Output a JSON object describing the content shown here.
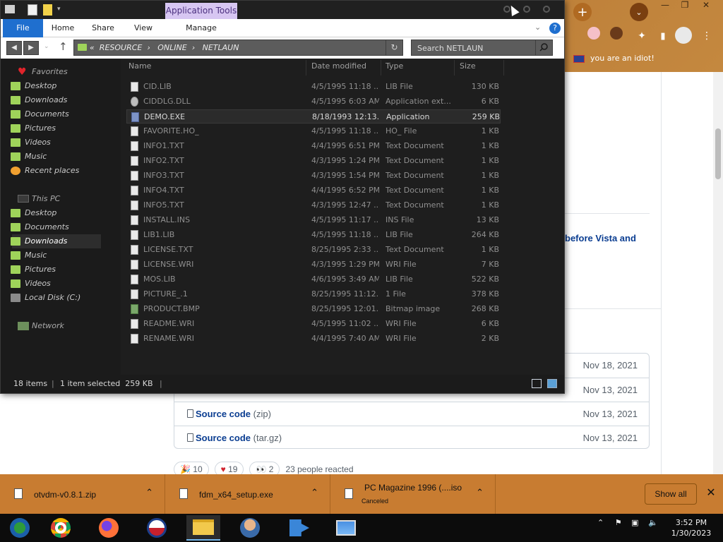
{
  "browser": {
    "bookmark_text": "you are an idiot!",
    "heading_fragment": "before Vista and",
    "assets": [
      {
        "name": "",
        "ext": "",
        "date": "Nov 18, 2021"
      },
      {
        "name": "",
        "ext": "",
        "date": "Nov 13, 2021"
      },
      {
        "name": "Source code",
        "ext": "(zip)",
        "date": "Nov 13, 2021"
      },
      {
        "name": "Source code",
        "ext": "(tar.gz)",
        "date": "Nov 13, 2021"
      }
    ],
    "reactions": {
      "tada": "10",
      "heart": "19",
      "eyes": "2",
      "summary": "23 people reacted"
    }
  },
  "explorer": {
    "contextual_tab": "Application Tools",
    "ribbon_tabs": [
      "File",
      "Home",
      "Share",
      "View",
      "Manage"
    ],
    "address_prefix": "«",
    "address_crumbs": [
      "RESOURCE",
      "ONLINE",
      "NETLAUN"
    ],
    "search_placeholder": "Search NETLAUN",
    "columns": {
      "name": "Name",
      "date": "Date modified",
      "type": "Type",
      "size": "Size"
    },
    "nav": {
      "favorites": "Favorites",
      "fav_items": [
        "Desktop",
        "Downloads",
        "Documents",
        "Pictures",
        "Videos",
        "Music",
        "Recent places"
      ],
      "this_pc": "This PC",
      "pc_items": [
        "Desktop",
        "Documents",
        "Downloads",
        "Music",
        "Pictures",
        "Videos",
        "Local Disk (C:)"
      ],
      "network": "Network"
    },
    "files": [
      {
        "name": "CID.LIB",
        "date": "4/5/1995 11:18 ...",
        "type": "LIB File",
        "size": "130 KB",
        "icon": "file"
      },
      {
        "name": "CIDDLG.DLL",
        "date": "4/5/1995 6:03 AM",
        "type": "Application ext...",
        "size": "6 KB",
        "icon": "gear"
      },
      {
        "name": "DEMO.EXE",
        "date": "8/18/1993 12:13...",
        "type": "Application",
        "size": "259 KB",
        "icon": "app"
      },
      {
        "name": "FAVORITE.HO_",
        "date": "4/5/1995 11:18 ...",
        "type": "HO_ File",
        "size": "1 KB",
        "icon": "file"
      },
      {
        "name": "INFO1.TXT",
        "date": "4/4/1995 6:51 PM",
        "type": "Text Document",
        "size": "1 KB",
        "icon": "file"
      },
      {
        "name": "INFO2.TXT",
        "date": "4/3/1995 1:24 PM",
        "type": "Text Document",
        "size": "1 KB",
        "icon": "file"
      },
      {
        "name": "INFO3.TXT",
        "date": "4/3/1995 1:54 PM",
        "type": "Text Document",
        "size": "1 KB",
        "icon": "file"
      },
      {
        "name": "INFO4.TXT",
        "date": "4/4/1995 6:52 PM",
        "type": "Text Document",
        "size": "1 KB",
        "icon": "file"
      },
      {
        "name": "INFO5.TXT",
        "date": "4/3/1995 12:47 ...",
        "type": "Text Document",
        "size": "1 KB",
        "icon": "file"
      },
      {
        "name": "INSTALL.INS",
        "date": "4/5/1995 11:17 ...",
        "type": "INS File",
        "size": "13 KB",
        "icon": "file"
      },
      {
        "name": "LIB1.LIB",
        "date": "4/5/1995 11:18 ...",
        "type": "LIB File",
        "size": "264 KB",
        "icon": "file"
      },
      {
        "name": "LICENSE.TXT",
        "date": "8/25/1995 2:33 ...",
        "type": "Text Document",
        "size": "1 KB",
        "icon": "file"
      },
      {
        "name": "LICENSE.WRI",
        "date": "4/3/1995 1:29 PM",
        "type": "WRI File",
        "size": "7 KB",
        "icon": "file"
      },
      {
        "name": "MOS.LIB",
        "date": "4/6/1995 3:49 AM",
        "type": "LIB File",
        "size": "522 KB",
        "icon": "file"
      },
      {
        "name": "PICTURE_.1",
        "date": "8/25/1995 11:12...",
        "type": "1 File",
        "size": "378 KB",
        "icon": "file"
      },
      {
        "name": "PRODUCT.BMP",
        "date": "8/25/1995 12:01...",
        "type": "Bitmap image",
        "size": "268 KB",
        "icon": "bmp"
      },
      {
        "name": "README.WRI",
        "date": "4/5/1995 11:02 ...",
        "type": "WRI File",
        "size": "6 KB",
        "icon": "file"
      },
      {
        "name": "RENAME.WRI",
        "date": "4/4/1995 7:40 AM",
        "type": "WRI File",
        "size": "2 KB",
        "icon": "file"
      }
    ],
    "selected_index": 2,
    "status": {
      "count": "18 items",
      "selection": "1 item selected  259 KB"
    }
  },
  "downloads": {
    "items": [
      {
        "name": "otvdm-v0.8.1.zip",
        "sub": ""
      },
      {
        "name": "fdm_x64_setup.exe",
        "sub": ""
      },
      {
        "name": "PC Magazine 1996 (....iso",
        "sub": "Canceled"
      }
    ],
    "show_all": "Show all"
  },
  "taskbar": {
    "apps": [
      "media-center-icon",
      "chrome-icon",
      "firefox-icon",
      "obama-logo-icon",
      "file-explorer-icon",
      "doctor-icon",
      "share-icon",
      "photos-icon"
    ],
    "time": "3:52 PM",
    "date": "1/30/2023"
  },
  "colors": {
    "accent": "#1f6fcf",
    "browser_theme": "#c87c31",
    "contextual_tab": "#d7c6f2"
  }
}
